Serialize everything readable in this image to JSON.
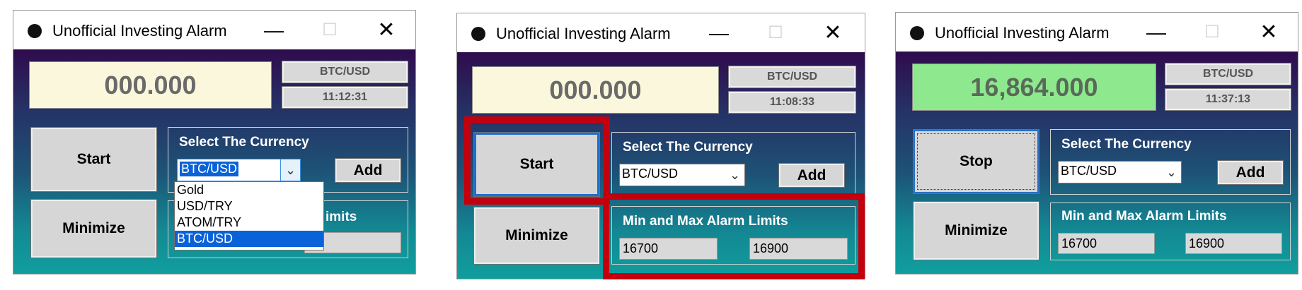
{
  "windows": [
    {
      "title": "Unofficial Investing Alarm",
      "price": "000.000",
      "pair": "BTC/USD",
      "time": "11:12:31",
      "primary_button": "Start",
      "minimize_button": "Minimize",
      "currency_group_label": "Select The Currency",
      "currency_selected": "BTC/USD",
      "add_button": "Add",
      "limits_group_label": "Min and Max Alarm Limits",
      "limits_visible_label": "imits",
      "dropdown_options": [
        "Gold",
        "USD/TRY",
        "ATOM/TRY",
        "BTC/USD"
      ],
      "dropdown_selected_index": 3
    },
    {
      "title": "Unofficial Investing Alarm",
      "price": "000.000",
      "pair": "BTC/USD",
      "time": "11:08:33",
      "primary_button": "Start",
      "minimize_button": "Minimize",
      "currency_group_label": "Select The Currency",
      "currency_selected": "BTC/USD",
      "add_button": "Add",
      "limits_group_label": "Min and Max Alarm Limits",
      "min_limit": "16700",
      "max_limit": "16900"
    },
    {
      "title": "Unofficial Investing Alarm",
      "price": "16,864.000",
      "pair": "BTC/USD",
      "time": "11:37:13",
      "primary_button": "Stop",
      "minimize_button": "Minimize",
      "currency_group_label": "Select The Currency",
      "currency_selected": "BTC/USD",
      "add_button": "Add",
      "limits_group_label": "Min and Max Alarm Limits",
      "min_limit": "16700",
      "max_limit": "16900"
    }
  ],
  "titlebar_glyphs": {
    "minimize": "—",
    "maximize": "☐",
    "close": "✕"
  },
  "colors": {
    "price_idle_bg": "#fbf7dc",
    "price_active_bg": "#8ee98e",
    "highlight": "#c4000c",
    "gradient_top": "#2f0b4d",
    "gradient_bottom": "#109e9d"
  }
}
